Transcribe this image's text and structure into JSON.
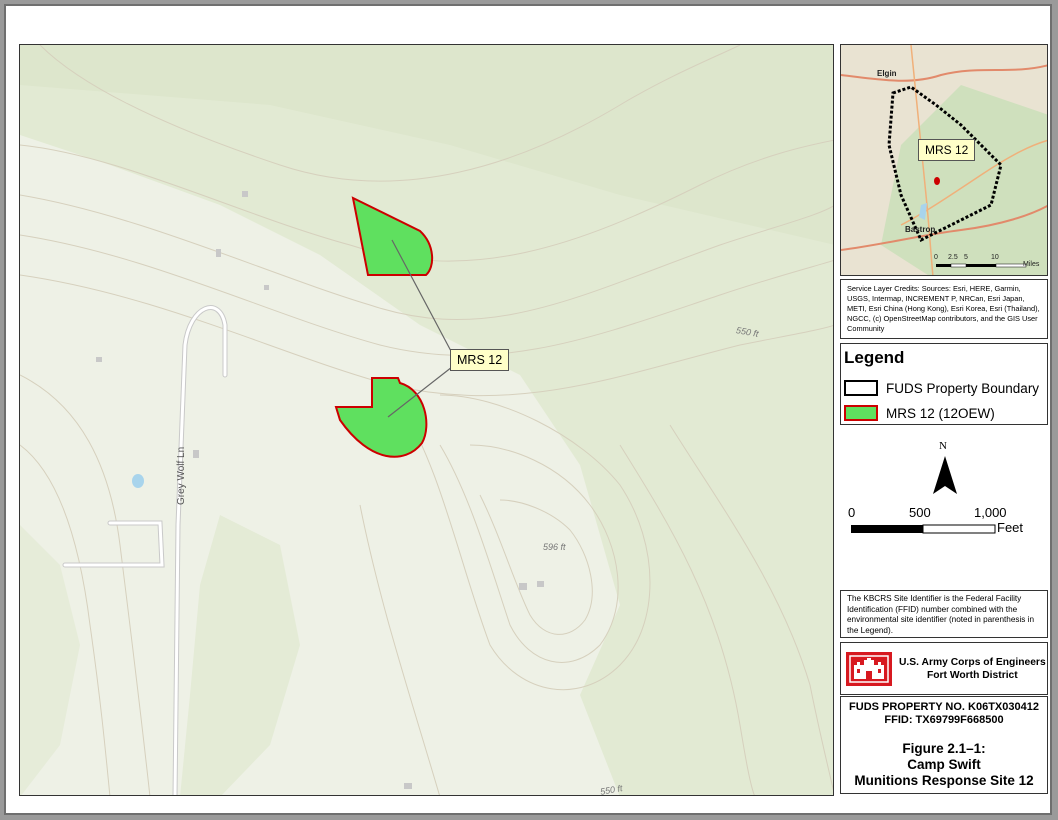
{
  "main_map": {
    "callout_label": "MRS 12",
    "road_label": "Grey Wolf Ln",
    "elevations": [
      "550 ft",
      "596 ft",
      "550 ft"
    ],
    "north_arrow": "N",
    "scale": {
      "ticks": [
        "0",
        "500",
        "1,000"
      ],
      "unit": "Feet"
    }
  },
  "inset": {
    "callout_label": "MRS 12",
    "towns": [
      "Elgin",
      "Bastrop"
    ],
    "scale_ticks": [
      "0",
      "2.5",
      "5",
      "10"
    ],
    "scale_unit": "Miles"
  },
  "credits": "Service Layer Credits: Sources: Esri, HERE, Garmin, USGS, Intermap, INCREMENT P, NRCan, Esri Japan, METI, Esri China (Hong Kong), Esri Korea, Esri (Thailand), NGCC, (c) OpenStreetMap contributors, and the GIS User Community",
  "legend": {
    "title": "Legend",
    "items": [
      {
        "label": "FUDS Property Boundary",
        "fill": "#ffffff",
        "stroke": "#000000"
      },
      {
        "label": "MRS 12 (12OEW)",
        "fill": "#5fe05f",
        "stroke": "#cc0000"
      }
    ]
  },
  "site_note": "The KBCRS Site Identifier is the Federal Facility Identification (FFID) number combined with the environmental site identifier (noted in parenthesis in the Legend).",
  "usace": {
    "line1": "U.S. Army Corps of Engineers",
    "line2": "Fort Worth District"
  },
  "title_block": {
    "property_no": "FUDS PROPERTY NO. K06TX030412",
    "ffid": "FFID: TX69799F668500",
    "figure": "Figure 2.1–1:",
    "site": "Camp Swift",
    "name": "Munitions Response Site 12"
  },
  "colors": {
    "mrs_fill": "#5fe05f",
    "mrs_stroke": "#cc0000",
    "label_bg": "#ffffc8",
    "usace_red": "#d71920"
  }
}
